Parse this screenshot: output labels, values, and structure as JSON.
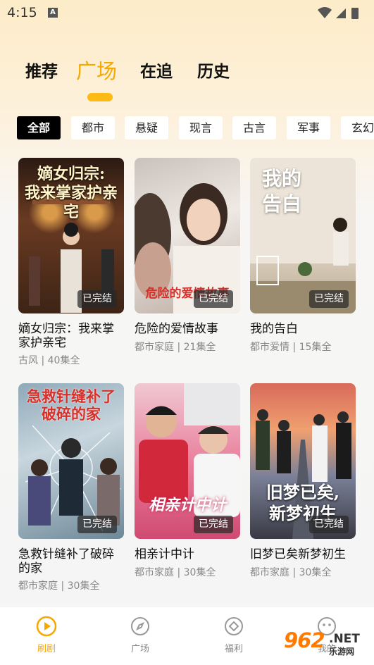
{
  "status_bar": {
    "time": "4:15",
    "notice": "A"
  },
  "top_tabs": [
    "推荐",
    "广场",
    "在追",
    "历史"
  ],
  "active_top_tab": "广场",
  "filters": [
    "全部",
    "都市",
    "悬疑",
    "现言",
    "古言",
    "军事",
    "玄幻"
  ],
  "active_filter": "全部",
  "dramas": [
    {
      "title": "嫡女归宗：我来掌家护亲宅",
      "poster_text": "嫡女归宗:\n我来掌家护亲宅",
      "category": "古风",
      "episodes": "40集全",
      "badge": "已完结"
    },
    {
      "title": "危险的爱情故事",
      "poster_text": "危险的爱情故事",
      "category": "都市家庭",
      "episodes": "21集全",
      "badge": "已完结"
    },
    {
      "title": "我的告白",
      "poster_text": "我的\n告白",
      "category": "都市爱情",
      "episodes": "15集全",
      "badge": "已完结"
    },
    {
      "title": "急救针缝补了破碎的家",
      "poster_text": "急救针缝补了\n破碎的家",
      "category": "都市家庭",
      "episodes": "30集全",
      "badge": "已完结"
    },
    {
      "title": "相亲计中计",
      "poster_text": "相亲计中计",
      "category": "都市家庭",
      "episodes": "30集全",
      "badge": "已完结"
    },
    {
      "title": "旧梦已矣新梦初生",
      "poster_text": "旧梦已矣,\n新梦初生",
      "category": "都市家庭",
      "episodes": "30集全",
      "badge": "已完结"
    }
  ],
  "meta_separator": "|",
  "bottom_nav": [
    {
      "label": "刷剧",
      "icon": "play-circle-icon"
    },
    {
      "label": "广场",
      "icon": "compass-icon"
    },
    {
      "label": "福利",
      "icon": "diamond-circle-icon"
    },
    {
      "label": "我的",
      "icon": "chat-face-icon"
    }
  ],
  "watermark": {
    "number": "962",
    "net": ".NET",
    "site": "乐游网"
  },
  "colors": {
    "accent": "#fbbb14",
    "accent_text": "#f5a900"
  }
}
